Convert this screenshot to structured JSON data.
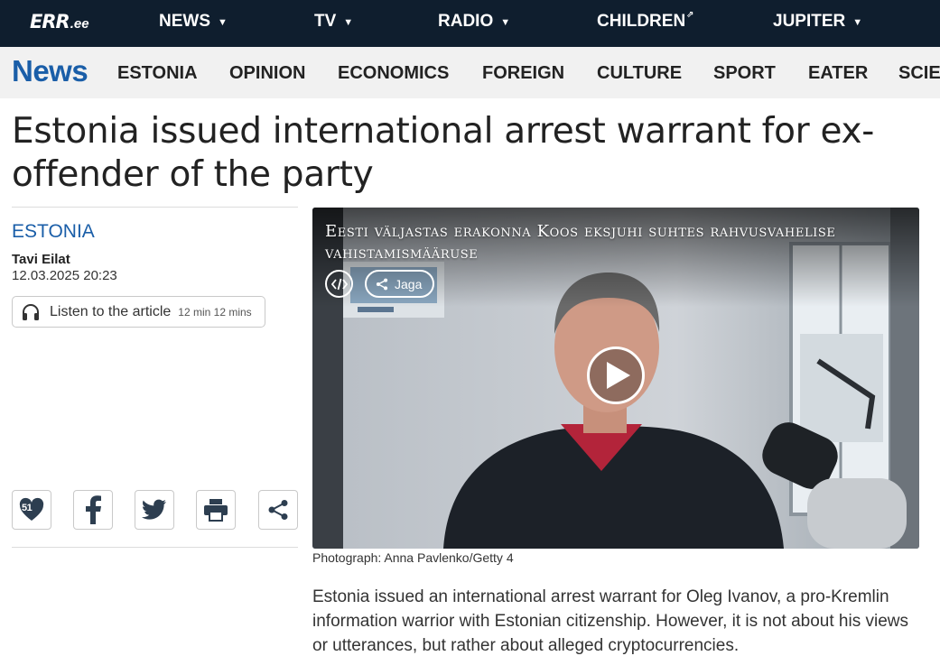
{
  "topnav": {
    "logo_mark": "ERR",
    "logo_tld": ".ee",
    "items": [
      {
        "label": "NEWS",
        "caret": "▼"
      },
      {
        "label": "TV",
        "caret": "▼"
      },
      {
        "label": "RADIO",
        "caret": "▼"
      },
      {
        "label": "CHILDREN",
        "external": "⇗"
      },
      {
        "label": "JUPITER",
        "caret": "▼"
      }
    ]
  },
  "sectionnav": {
    "brand": "News",
    "items": [
      "ESTONIA",
      "OPINION",
      "ECONOMICS",
      "FOREIGN",
      "CULTURE",
      "SPORT",
      "EATER",
      "SCIE"
    ]
  },
  "article": {
    "headline": "Estonia issued international arrest warrant for ex-offender of the party",
    "category": "ESTONIA",
    "author": "Tavi Eilat",
    "datetime": "12.03.2025 20:23",
    "listen": {
      "label": "Listen to the article",
      "duration": "12 min 12 mins"
    },
    "like_count": "51",
    "share_icons": [
      "heart-icon",
      "facebook-icon",
      "twitter-icon",
      "print-icon",
      "share-icon"
    ],
    "video": {
      "title": "Eesti väljastas erakonna Koos eksjuhi suhtes rahvusvahelise vahistamismääruse",
      "share_label": "Jaga"
    },
    "caption": "Photograph: Anna Pavlenko/Getty 4",
    "lead": "Estonia issued an international arrest warrant for Oleg Ivanov, a pro-Kremlin information warrior with Estonian citizenship. However, it is not about his views or utterances, but rather about alleged cryptocurrencies."
  },
  "colors": {
    "topbar": "#0f1e2e",
    "brand_blue": "#1a5ea8",
    "secbar": "#f1f1f1"
  }
}
